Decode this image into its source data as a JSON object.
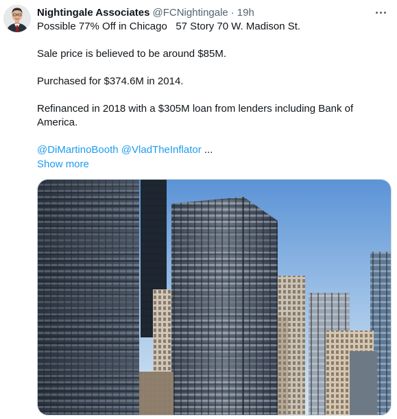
{
  "author": {
    "name": "Nightingale Associates",
    "handle": "@FCNightingale",
    "separator": "·",
    "time": "19h"
  },
  "tweet": {
    "line1": "Possible 77% Off in Chicago   57 Story 70 W. Madison St.",
    "line2": "Sale price is believed to be around $85M.",
    "line3": "Purchased for $374.6M in 2014.",
    "line4": "Refinanced in 2018 with a $305M loan from lenders including Bank of America.",
    "mention1": "@DiMartinoBooth",
    "mention2": "@VladTheInflator",
    "ellipsis": " ...",
    "show_more": "Show more"
  },
  "icons": {
    "more": "more-dots-icon",
    "avatar": "profile-photo",
    "media": "skyscraper-photo"
  },
  "colors": {
    "link": "#1d9bf0",
    "secondary_text": "#536471",
    "primary_text": "#0f1419"
  }
}
